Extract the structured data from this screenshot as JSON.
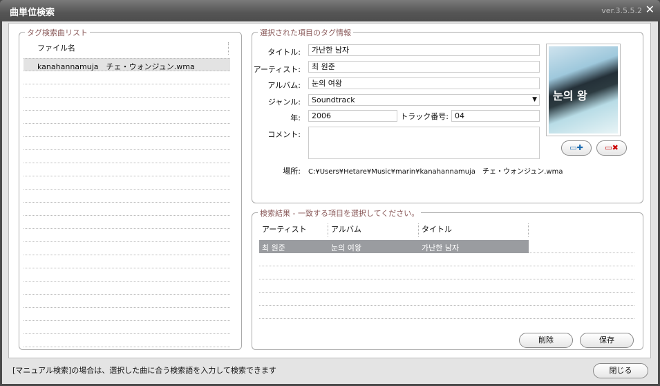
{
  "window": {
    "title": "曲単位検索",
    "version": "ver.3.5.5.2"
  },
  "file_list": {
    "legend": "タグ検索曲リスト",
    "column": "ファイル名",
    "items": [
      "kanahannamuja　チェ・ウォンジュン.wma"
    ]
  },
  "tag_info": {
    "legend": "選択された項目のタグ情報",
    "labels": {
      "title": "タイトル:",
      "artist": "アーティスト:",
      "album": "アルバム:",
      "genre": "ジャンル:",
      "year": "年:",
      "track": "トラック番号:",
      "comment": "コメント:",
      "location": "場所:"
    },
    "values": {
      "title": "가난한 남자",
      "artist": "최 원준",
      "album": "눈의 여왕",
      "genre": "Soundtrack",
      "year": "2006",
      "track": "04",
      "comment": "",
      "location": "C:¥Users¥Hetare¥Music¥marin¥kanahannamuja　チェ・ウォンジュン.wma"
    }
  },
  "results": {
    "legend": "検索結果 - 一致する項目を選択してください。",
    "columns": [
      "アーティスト",
      "アルバム",
      "タイトル"
    ],
    "rows": [
      [
        "최 원준",
        "눈의 여왕",
        "가난한 남자"
      ]
    ],
    "delete_label": "削除",
    "save_label": "保存"
  },
  "status": "[マニュアル検索]の場合は、選択した曲に合う検索語を入力して検索できます",
  "close_label": "閉じる"
}
